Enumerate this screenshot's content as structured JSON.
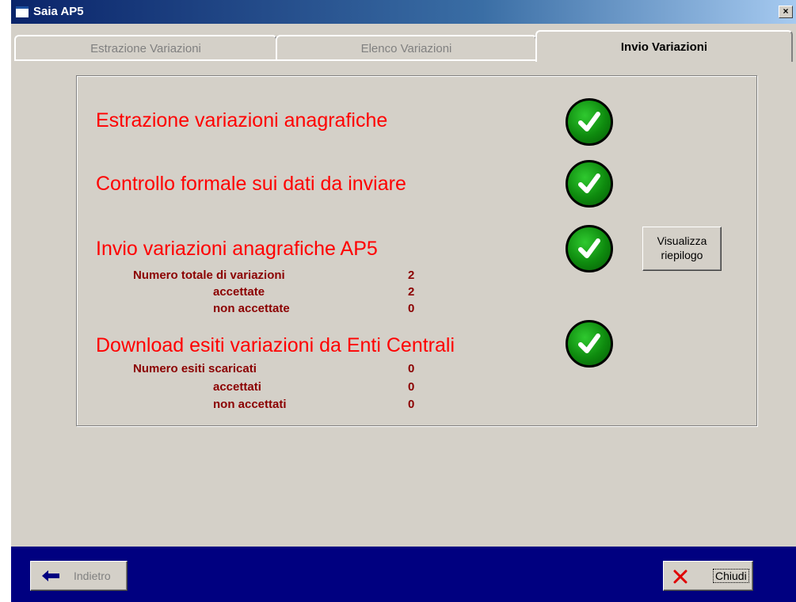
{
  "window": {
    "title": "Saia AP5",
    "close_label": "×"
  },
  "tabs": [
    {
      "label": "Estrazione Variazioni",
      "active": false
    },
    {
      "label": "Elenco Variazioni",
      "active": false
    },
    {
      "label": "Invio Variazioni",
      "active": true
    }
  ],
  "steps": [
    {
      "label": "Estrazione variazioni anagrafiche",
      "status_icon": "check-icon"
    },
    {
      "label": "Controllo formale sui dati da inviare",
      "status_icon": "check-icon"
    },
    {
      "label": "Invio variazioni anagrafiche AP5",
      "status_icon": "check-icon",
      "details": [
        {
          "label": "Numero totale di variazioni",
          "value": "2"
        },
        {
          "label": "accettate",
          "value": "2"
        },
        {
          "label": "non accettate",
          "value": "0"
        }
      ]
    },
    {
      "label": "Download esiti variazioni da Enti Centrali",
      "status_icon": "check-icon",
      "details": [
        {
          "label": "Numero esiti scaricati",
          "value": "0"
        },
        {
          "label": "accettati",
          "value": "0"
        },
        {
          "label": "non accettati",
          "value": "0"
        }
      ]
    }
  ],
  "buttons": {
    "riepilogo_line1": "Visualizza",
    "riepilogo_line2": "riepilogo",
    "back": "Indietro",
    "close": "Chiudi"
  },
  "colors": {
    "step_text": "#ff0000",
    "detail_text": "#8b0000",
    "check_green": "#0e8a0e",
    "bottom_bar": "#000080"
  }
}
